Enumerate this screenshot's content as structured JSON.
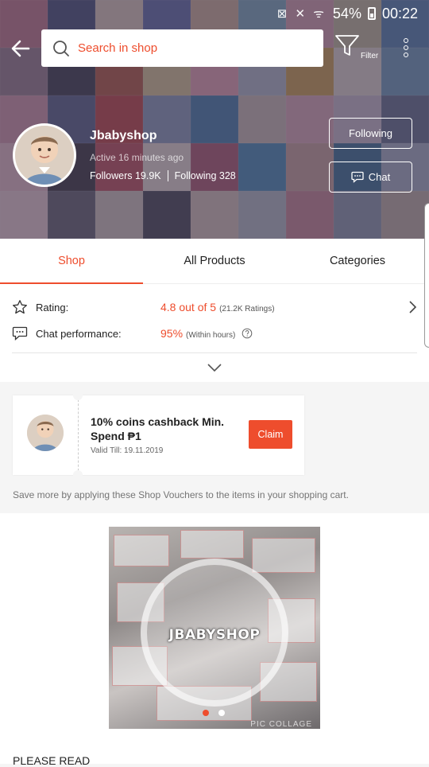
{
  "status_bar": {
    "battery": "54%",
    "time": "00:22"
  },
  "search": {
    "placeholder": "Search in shop"
  },
  "filter": {
    "label": "Filter"
  },
  "shop": {
    "name": "Jbabyshop",
    "active": "Active 16 minutes ago",
    "followers": "Followers 19.9K",
    "following": "Following 328"
  },
  "actions": {
    "following_label": "Following",
    "chat_label": "Chat"
  },
  "tabs": [
    {
      "label": "Shop"
    },
    {
      "label": "All Products"
    },
    {
      "label": "Categories"
    }
  ],
  "stats": {
    "rating_label": "Rating:",
    "rating_value": "4.8 out of 5",
    "rating_count": "(21.2K Ratings)",
    "chat_label": "Chat performance:",
    "chat_value": "95%",
    "chat_sub": "(Within hours)"
  },
  "voucher": {
    "title": "10% coins cashback Min. Spend ₱1",
    "valid": "Valid Till: 19.11.2019",
    "claim_label": "Claim",
    "note": "Save more by applying these Shop Vouchers to the items in your shopping cart."
  },
  "banner": {
    "brand": "JBABYSHOP",
    "watermark": "PIC COLLAGE"
  },
  "please_read": "PLEASE READ",
  "colors": {
    "accent": "#ee4d2d"
  }
}
